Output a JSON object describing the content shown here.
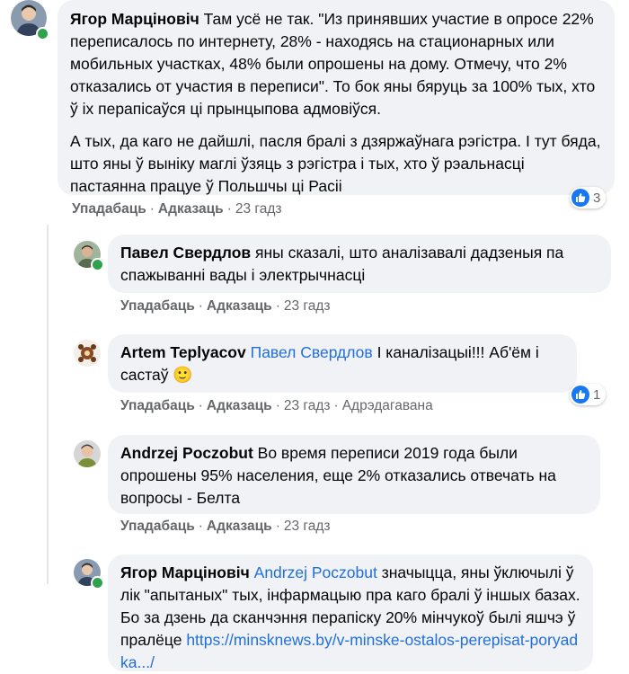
{
  "colors": {
    "bubble": "#f0f2f5",
    "author": "#050505",
    "mention": "#216fdb",
    "meta": "#65676b",
    "like": "#1877f2",
    "online": "#31a24c"
  },
  "comments": [
    {
      "author": "Ягор Марціновіч",
      "avatar_icon": "user-avatar-icon",
      "online": true,
      "paragraph1": "Там усё не так. \"Из принявших участие в опросе 22% переписалось по интернету, 28% - находясь на стационарных или мобильных участках, 48% были опрошены на дому. Отмечу, что 2% отказались от участия в переписи\". То бок яны бяруць за 100% тых, хто ў іх перапісаўся ці прынцыпова адмовіўся.",
      "paragraph2": "А тых, да каго не дайшлі, пасля бралі з дзяржаўнага рэгістра. І тут бяда, што яны ў выніку маглі ўзяць з рэгістра і тых, хто ў рэальнасці пастаянна працуе ў Польшчы ці Расіі",
      "like": "Упадабаць",
      "reply": "Адказаць",
      "time": "23 гадз",
      "reactions": "3"
    },
    {
      "author": "Павел Свердлов",
      "avatar_icon": "user-avatar-icon",
      "online": true,
      "text": "яны сказалі, што аналізавалі дадзеныя па спажыванні вады і электрычнасці",
      "like": "Упадабаць",
      "reply": "Адказаць",
      "time": "23 гадз"
    },
    {
      "author": "Artem Teplyacov",
      "avatar_icon": "user-avatar-icon",
      "online": false,
      "mention": "Павел Свердлов",
      "text": "І каналізацыі!!! Аб'ём і састаў",
      "emoji": "🙂",
      "like": "Упадабаць",
      "reply": "Адказаць",
      "time": "23 гадз",
      "edited": "Адрэдагавана",
      "reactions": "1"
    },
    {
      "author": "Andrzej Poczobut",
      "avatar_icon": "user-avatar-icon",
      "online": false,
      "text": "Во время переписи 2019 года были опрошены 95% населения, еще 2% отказались отвечать на вопросы - Белта",
      "like": "Упадабаць",
      "reply": "Адказаць",
      "time": "23 гадз"
    },
    {
      "author": "Ягор Марціновіч",
      "avatar_icon": "user-avatar-icon",
      "online": true,
      "mention": "Andrzej Poczobut",
      "text": "значыцца, яны ўключылі ў лік \"апытаных\" тых, інфармацыю пра каго бралі ў іншых базах. Бо за дзень да сканчэння перапіску 20% мінчукоў былі яшчэ ў пралёце",
      "link": "https://minsknews.by/v-minske-ostalos-perepisat-poryadka.../"
    }
  ]
}
